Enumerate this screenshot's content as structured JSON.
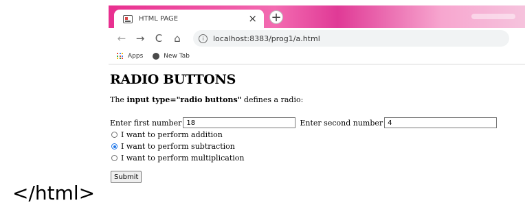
{
  "outside_caption": "</html>",
  "browser": {
    "tab": {
      "title": "HTML PAGE",
      "close_glyph": "×",
      "favicon": "page-icon"
    },
    "new_tab_glyph": "+",
    "toolbar": {
      "back_glyph": "←",
      "forward_glyph": "→",
      "reload_glyph": "C",
      "home_glyph": "⌂",
      "info_glyph": "i",
      "url": "localhost:8383/prog1/a.html"
    },
    "bookmarks": {
      "apps_label": "Apps",
      "new_tab_label": "New Tab"
    },
    "accent_color": "#1a73e8",
    "tabstrip_color": "#e82f8f"
  },
  "page": {
    "heading": "RADIO BUTTONS",
    "desc_prefix": "The ",
    "desc_bold": "input type=\"radio buttons\"",
    "desc_suffix": " defines a radio:",
    "first_label": "Enter first number",
    "first_value": "18",
    "second_label": "Enter second number",
    "second_value": "4",
    "options": [
      {
        "label": "I want to perform addition",
        "checked": false
      },
      {
        "label": "I want to perform subtraction",
        "checked": true
      },
      {
        "label": "I want to perform multiplication",
        "checked": false
      }
    ],
    "submit_label": "Submit"
  }
}
